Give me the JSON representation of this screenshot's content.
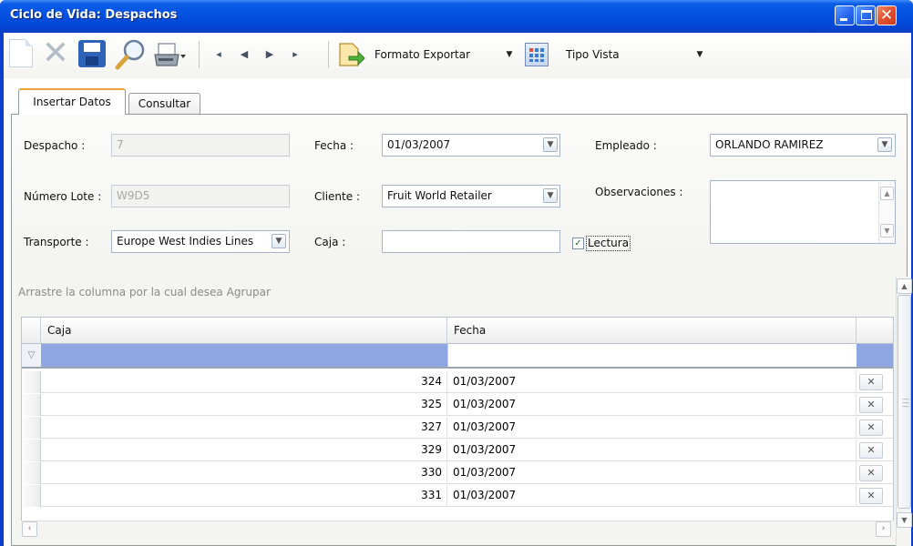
{
  "window": {
    "title": "Ciclo de Vida: Despachos",
    "close_glyph": "✕"
  },
  "toolbar": {
    "delete_glyph": "✕",
    "nav_first": "◂",
    "nav_prev": "◀",
    "nav_next": "▶",
    "nav_last": "▸",
    "format_export": "Formato Exportar",
    "view_type": "Tipo Vista",
    "dropdown_glyph": "▼"
  },
  "tabs": {
    "insert": "Insertar Datos",
    "query": "Consultar"
  },
  "form": {
    "despacho_label": "Despacho :",
    "despacho_value": "7",
    "numero_lote_label": "Número Lote :",
    "numero_lote_value": "W9D5",
    "transporte_label": "Transporte :",
    "transporte_value": "Europe West Indies Lines",
    "fecha_label": "Fecha :",
    "fecha_value": "01/03/2007",
    "cliente_label": "Cliente :",
    "cliente_value": "Fruit World Retailer",
    "caja_label": "Caja :",
    "caja_value": "",
    "lectura_label": "Lectura",
    "lectura_checked": true,
    "empleado_label": "Empleado :",
    "empleado_value": "ORLANDO RAMIREZ",
    "observaciones_label": "Observaciones :",
    "observaciones_value": ""
  },
  "grid": {
    "group_hint": "Arrastre la columna por la cual desea Agrupar",
    "columns": [
      "Caja",
      "Fecha"
    ],
    "delete_glyph": "✕",
    "rows": [
      {
        "caja": "324",
        "fecha": "01/03/2007"
      },
      {
        "caja": "325",
        "fecha": "01/03/2007"
      },
      {
        "caja": "327",
        "fecha": "01/03/2007"
      },
      {
        "caja": "329",
        "fecha": "01/03/2007"
      },
      {
        "caja": "330",
        "fecha": "01/03/2007"
      },
      {
        "caja": "331",
        "fecha": "01/03/2007"
      }
    ]
  },
  "colors": {
    "titlebar": "#0551e0",
    "filter_row": "#8ea6e2",
    "tab_accent": "#e8a33d"
  }
}
